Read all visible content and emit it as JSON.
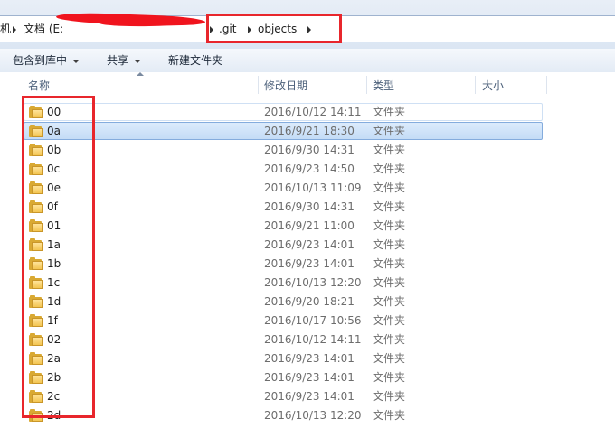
{
  "address": {
    "crumb_first": "机",
    "crumb_docs": "文档 (E:",
    "crumb_git": ".git",
    "crumb_objects": "objects"
  },
  "toolbar": {
    "include_library": "包含到库中",
    "share": "共享",
    "new_folder": "新建文件夹"
  },
  "columns": {
    "name": "名称",
    "modified": "修改日期",
    "type": "类型",
    "size": "大小"
  },
  "files": [
    {
      "name": "00",
      "date": "2016/10/12 14:11",
      "type": "文件夹"
    },
    {
      "name": "0a",
      "date": "2016/9/21 18:30",
      "type": "文件夹"
    },
    {
      "name": "0b",
      "date": "2016/9/30 14:31",
      "type": "文件夹"
    },
    {
      "name": "0c",
      "date": "2016/9/23 14:50",
      "type": "文件夹"
    },
    {
      "name": "0e",
      "date": "2016/10/13 11:09",
      "type": "文件夹"
    },
    {
      "name": "0f",
      "date": "2016/9/30 14:31",
      "type": "文件夹"
    },
    {
      "name": "01",
      "date": "2016/9/21 11:00",
      "type": "文件夹"
    },
    {
      "name": "1a",
      "date": "2016/9/23 14:01",
      "type": "文件夹"
    },
    {
      "name": "1b",
      "date": "2016/9/23 14:01",
      "type": "文件夹"
    },
    {
      "name": "1c",
      "date": "2016/10/13 12:20",
      "type": "文件夹"
    },
    {
      "name": "1d",
      "date": "2016/9/20 18:21",
      "type": "文件夹"
    },
    {
      "name": "1f",
      "date": "2016/10/17 10:56",
      "type": "文件夹"
    },
    {
      "name": "02",
      "date": "2016/10/12 14:11",
      "type": "文件夹"
    },
    {
      "name": "2a",
      "date": "2016/9/23 14:01",
      "type": "文件夹"
    },
    {
      "name": "2b",
      "date": "2016/9/23 14:01",
      "type": "文件夹"
    },
    {
      "name": "2c",
      "date": "2016/9/23 14:01",
      "type": "文件夹"
    },
    {
      "name": "2d",
      "date": "2016/10/13 12:20",
      "type": "文件夹"
    }
  ],
  "selected_index": 1,
  "hover_index": 0,
  "colors": {
    "annotation_red": "#e8262c",
    "selection_fill": "#c4dcf6",
    "folder_yellow": "#f3c551"
  }
}
